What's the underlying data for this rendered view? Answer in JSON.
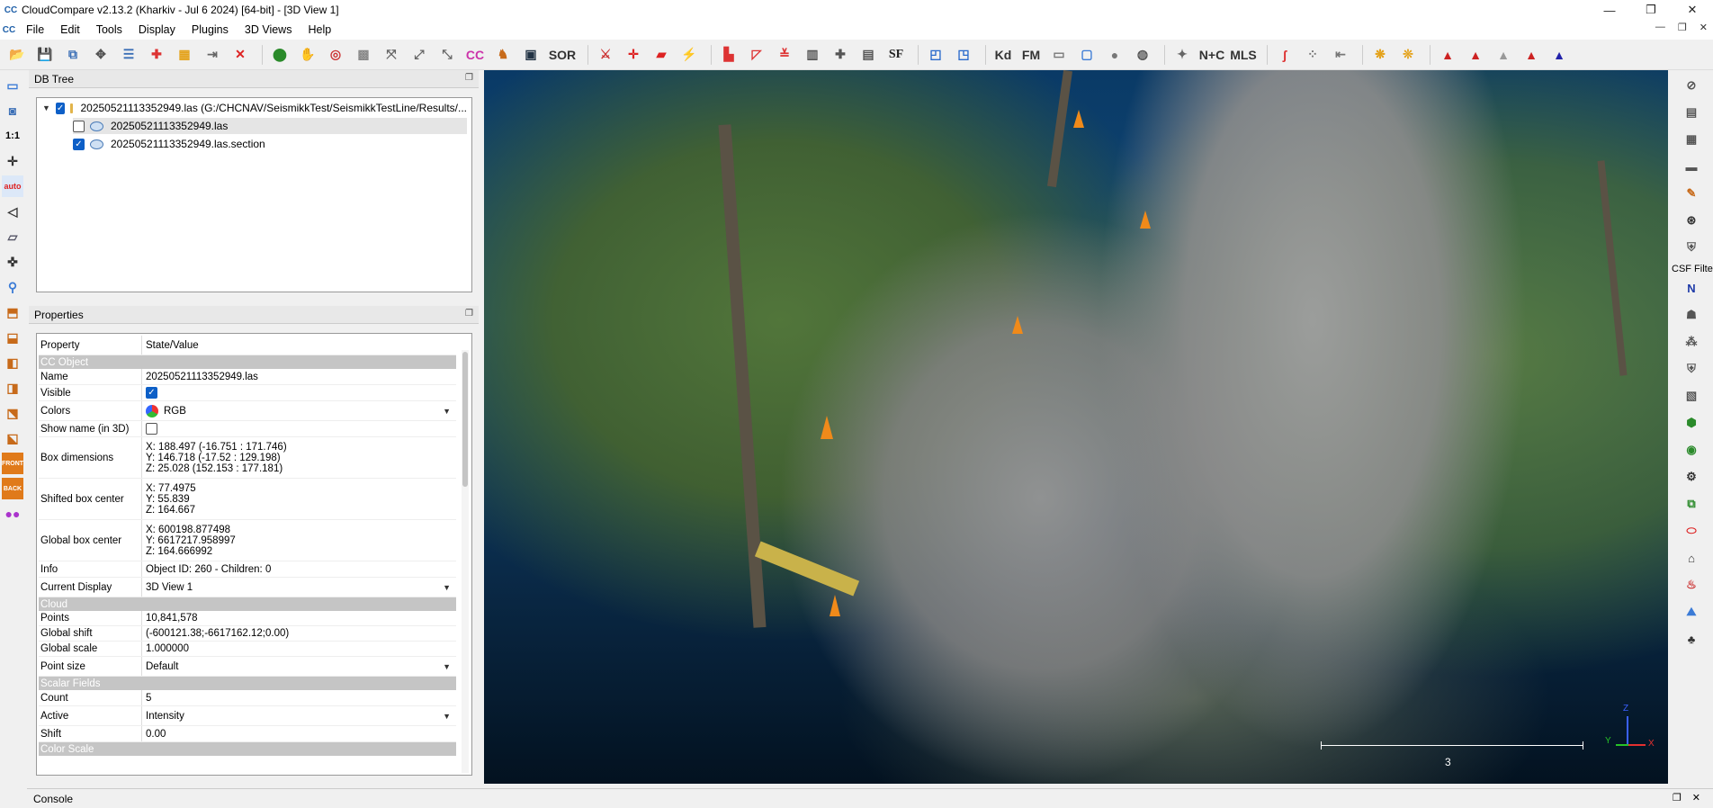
{
  "window": {
    "title": "CloudCompare v2.13.2 (Kharkiv - Jul  6 2024) [64-bit] - [3D View 1]",
    "app_icon": "CC",
    "controls": [
      "—",
      "❐",
      "✕"
    ]
  },
  "menubar": {
    "items": [
      "File",
      "Edit",
      "Tools",
      "Display",
      "Plugins",
      "3D Views",
      "Help"
    ],
    "mdi_controls": [
      "—",
      "❐",
      "✕"
    ]
  },
  "toolbar": {
    "sor_label": "SOR",
    "sf_label": "SF",
    "kd_label": "Kd",
    "fm_label": "FM",
    "nc_label": "N+C",
    "mls_label": "MLS"
  },
  "left_tools": {
    "one_to_one": "1:1",
    "auto": "auto",
    "front": "FRONT",
    "back": "BACK"
  },
  "dbtree": {
    "title": "DB Tree",
    "root": {
      "label": "20250521113352949.las (G:/CHCNAV/SeismikkTest/SeismikkTestLine/Results/...",
      "checked": true
    },
    "children": [
      {
        "label": "20250521113352949.las",
        "checked": false,
        "selected": true
      },
      {
        "label": "20250521113352949.las.section",
        "checked": true,
        "selected": false
      }
    ]
  },
  "properties": {
    "title": "Properties",
    "header": {
      "property": "Property",
      "value": "State/Value"
    },
    "sections": {
      "cc_object": "CC Object",
      "cloud": "Cloud",
      "scalar_fields": "Scalar Fields",
      "color_scale": "Color Scale"
    },
    "name": {
      "label": "Name",
      "value": "20250521113352949.las"
    },
    "visible": {
      "label": "Visible",
      "checked": true
    },
    "colors": {
      "label": "Colors",
      "value": "RGB"
    },
    "show_name": {
      "label": "Show name (in 3D)",
      "checked": false
    },
    "box_dimensions": {
      "label": "Box dimensions",
      "x": "X: 188.497 (-16.751 : 171.746)",
      "y": "Y: 146.718 (-17.52 : 129.198)",
      "z": "Z: 25.028 (152.153 : 177.181)"
    },
    "shifted_box_center": {
      "label": "Shifted box center",
      "x": "X: 77.4975",
      "y": "Y: 55.839",
      "z": "Z: 164.667"
    },
    "global_box_center": {
      "label": "Global box center",
      "x": "X: 600198.877498",
      "y": "Y: 6617217.958997",
      "z": "Z: 164.666992"
    },
    "info": {
      "label": "Info",
      "value": "Object ID: 260 - Children: 0"
    },
    "current_display": {
      "label": "Current Display",
      "value": "3D View 1"
    },
    "points": {
      "label": "Points",
      "value": "10,841,578"
    },
    "global_shift": {
      "label": "Global shift",
      "value": "(-600121.38;-6617162.12;0.00)"
    },
    "global_scale": {
      "label": "Global scale",
      "value": "1.000000"
    },
    "point_size": {
      "label": "Point size",
      "value": "Default"
    },
    "count": {
      "label": "Count",
      "value": "5"
    },
    "active": {
      "label": "Active",
      "value": "Intensity"
    },
    "shift": {
      "label": "Shift",
      "value": "0.00"
    }
  },
  "view3d": {
    "scale_label": "3",
    "axis": {
      "x": "X",
      "y": "Y",
      "z": "Z"
    }
  },
  "right_tools": {
    "csf_label": "CSF Filte",
    "n_label": "N"
  },
  "console": {
    "title": "Console"
  }
}
